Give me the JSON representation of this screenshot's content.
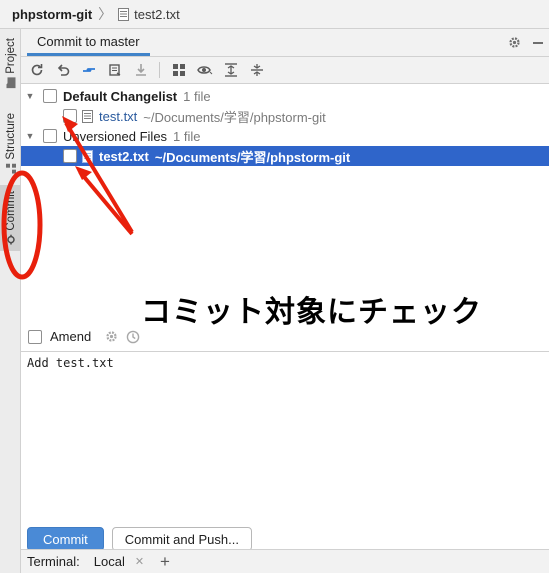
{
  "breadcrumb": {
    "project": "phpstorm-git",
    "file": "test2.txt"
  },
  "stripe": {
    "project_label": "Project",
    "structure_label": "Structure",
    "commit_label": "Commit"
  },
  "panel": {
    "tab_label": "Commit to master"
  },
  "toolbar": {
    "icons": [
      "refresh-icon",
      "rollback-icon",
      "diff-icon",
      "shelve-icon",
      "update-icon",
      "group-icon",
      "view-icon",
      "expand-all-icon",
      "collapse-all-icon"
    ]
  },
  "tree": {
    "changelist": {
      "name": "Default Changelist",
      "count": "1 file"
    },
    "changelist_file": {
      "name": "test.txt",
      "path": "~/Documents/学習/phpstorm-git"
    },
    "unversioned": {
      "name": "Unversioned Files",
      "count": "1 file"
    },
    "unversioned_file": {
      "name": "test2.txt",
      "path": "~/Documents/学習/phpstorm-git"
    }
  },
  "annotation": "コミット対象にチェック",
  "amend": {
    "label": "Amend"
  },
  "message": {
    "text": "Add test.txt"
  },
  "actions": {
    "commit": "Commit",
    "commit_push": "Commit and Push..."
  },
  "bottom": {
    "terminal": "Terminal:",
    "local": "Local"
  },
  "colors": {
    "accent": "#4083c9",
    "selection": "#2f65ca",
    "annotation_red": "#e8200c",
    "primary_button": "#4a8ad6"
  }
}
